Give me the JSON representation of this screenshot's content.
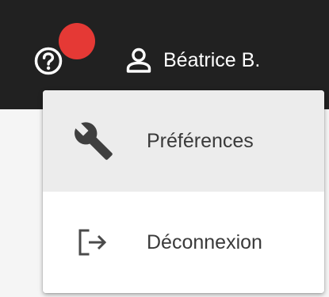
{
  "header": {
    "help_icon": "help-circle-icon",
    "user_icon": "person-outline-icon",
    "user_name": "Béatrice B.",
    "notification_color": "#e53935",
    "background_color": "#212121"
  },
  "menu": {
    "items": [
      {
        "label": "Préférences",
        "icon": "wrench-icon",
        "highlighted": true
      },
      {
        "label": "Déconnexion",
        "icon": "logout-icon",
        "highlighted": false
      }
    ],
    "highlight_color": "#ececec"
  }
}
